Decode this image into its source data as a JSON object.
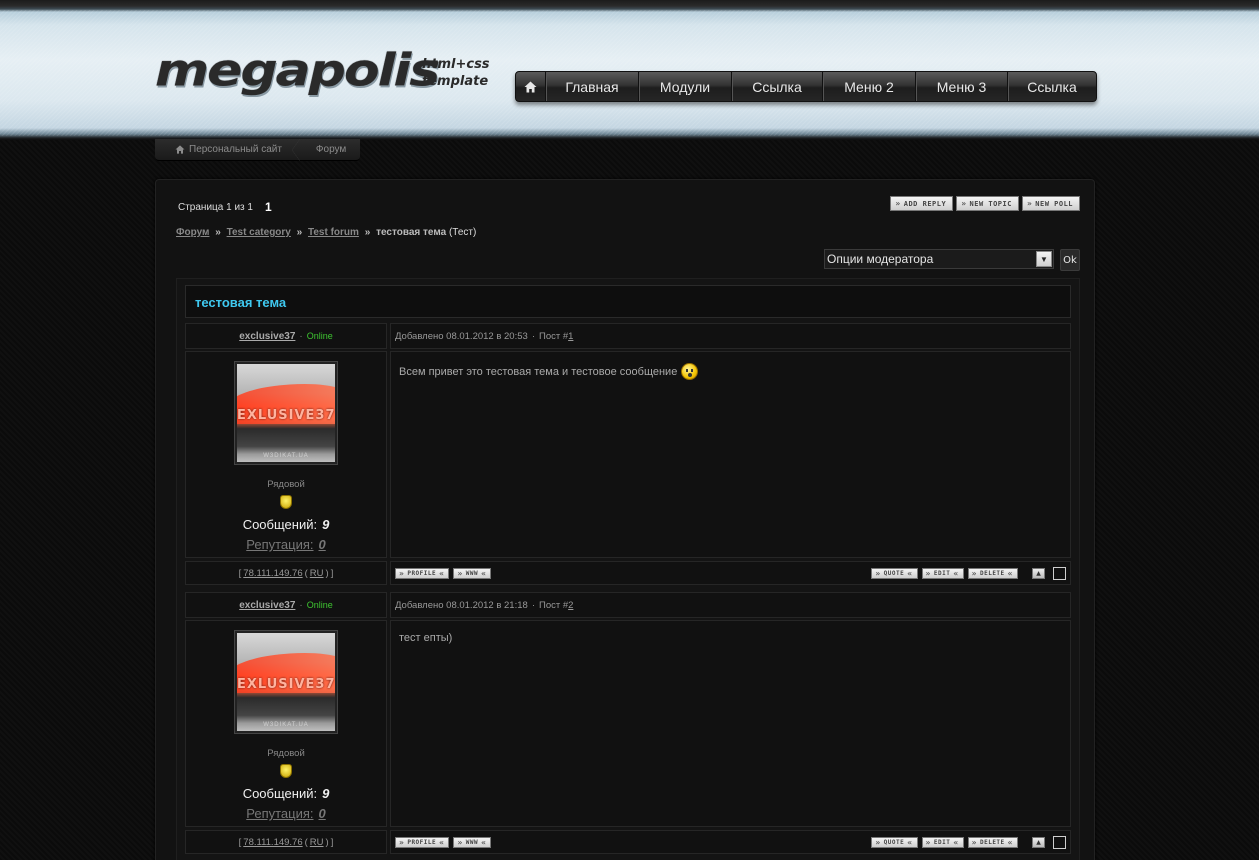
{
  "header": {
    "logo_word": "megapolis",
    "logo_sub_1": "html+css",
    "logo_sub_2": "template",
    "nav": [
      "Главная",
      "Модули",
      "Ссылка",
      "Меню 2",
      "Меню 3",
      "Ссылка"
    ]
  },
  "crumbs": [
    "Персональный сайт",
    "Форум"
  ],
  "pager": {
    "label": "Страница 1 из 1",
    "current": "1"
  },
  "top_buttons": [
    "ADD REPLY",
    "NEW TOPIC",
    "NEW POLL"
  ],
  "path": {
    "forum": "Форум",
    "category": "Test category",
    "subforum": "Test forum",
    "topic": "тестовая тема",
    "tag": "(Тест)",
    "sep": "»"
  },
  "moderator": {
    "select_value": "Опции модератора",
    "ok_label": "Ok"
  },
  "topic_title": "тестовая тема",
  "posts": [
    {
      "username": "exclusive37",
      "status": "Online",
      "added_prefix": "Добавлено 08.01.2012 в 20:53",
      "post_label": "Пост #",
      "post_num": "1",
      "avatar_text": "EXLUSIVE37",
      "avatar_foot": "W3DIKAT.UA",
      "rank": "Рядовой",
      "messages_label": "Сообщений:",
      "messages_count": "9",
      "reputation_label": "Репутация:",
      "reputation_value": "0",
      "text": "Всем привет это тестовая тема и тестовое сообщение",
      "has_smile": true,
      "ip": "78.111.149.76",
      "country": "RU"
    },
    {
      "username": "exclusive37",
      "status": "Online",
      "added_prefix": "Добавлено 08.01.2012 в 21:18",
      "post_label": "Пост #",
      "post_num": "2",
      "avatar_text": "EXLUSIVE37",
      "avatar_foot": "W3DIKAT.UA",
      "rank": "Рядовой",
      "messages_label": "Сообщений:",
      "messages_count": "9",
      "reputation_label": "Репутация:",
      "reputation_value": "0",
      "text": "тест епты)",
      "has_smile": false,
      "ip": "78.111.149.76",
      "country": "RU"
    }
  ],
  "post_buttons_left": [
    "PROFILE",
    "WWW"
  ],
  "post_buttons_right": [
    "QUOTE",
    "EDIT",
    "DELETE"
  ]
}
